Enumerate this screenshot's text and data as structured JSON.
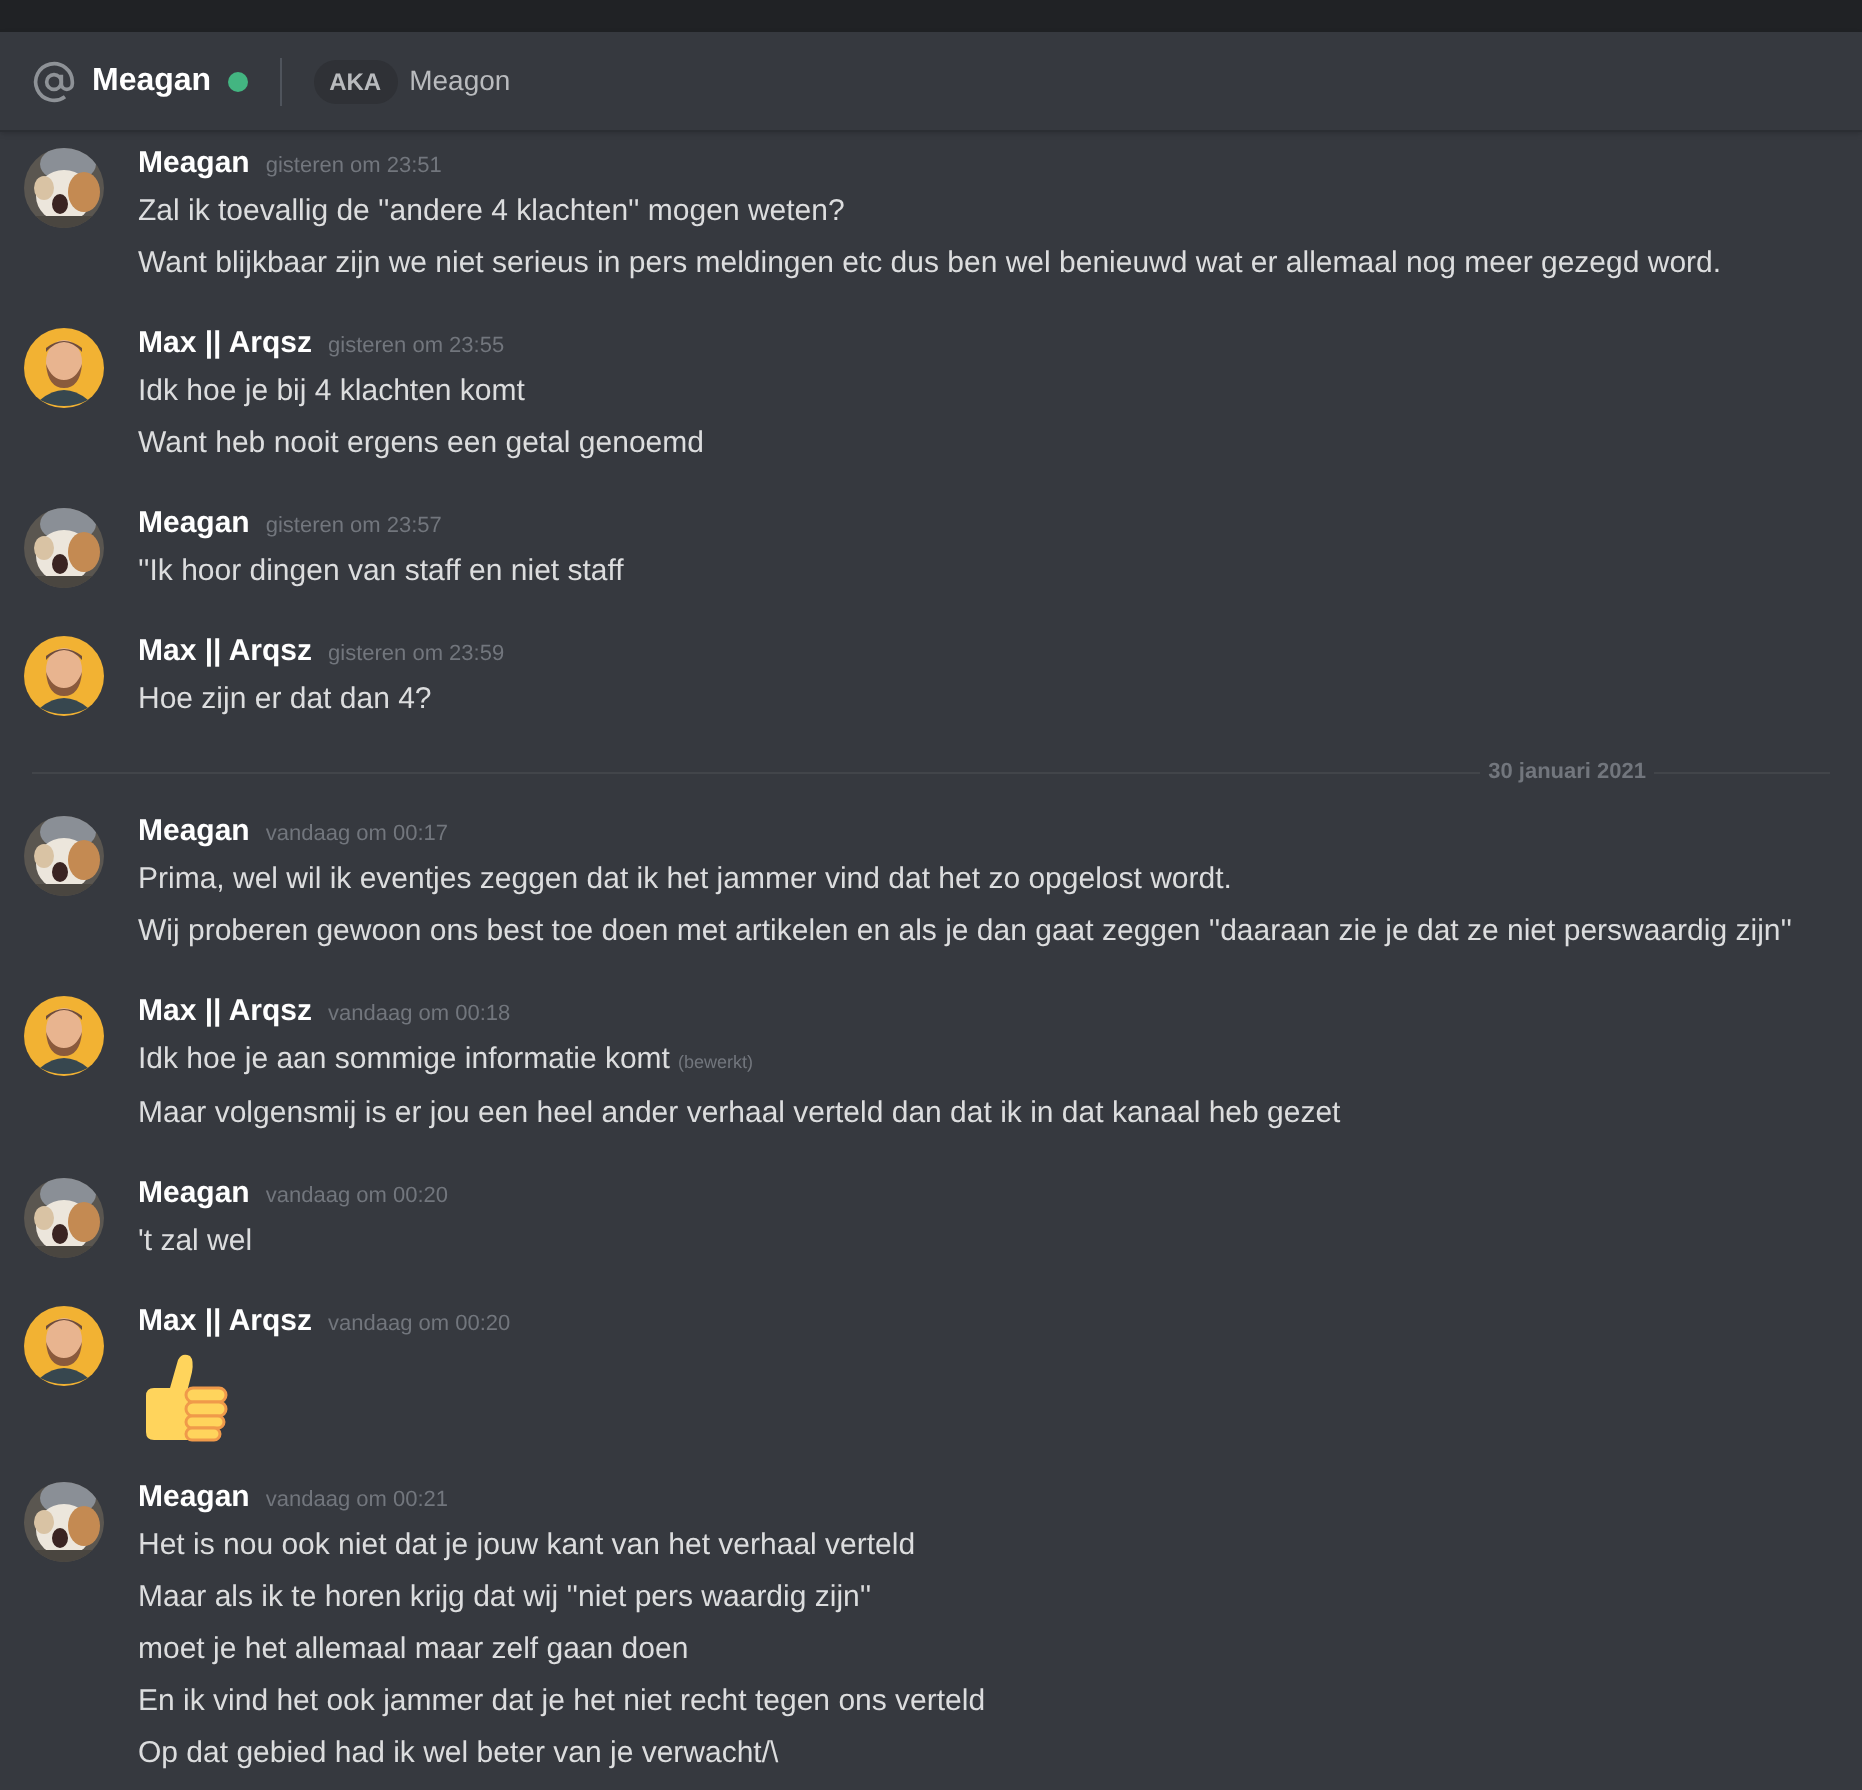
{
  "header": {
    "name": "Meagan",
    "online": true,
    "aka_label": "AKA",
    "aka_name": "Meagon"
  },
  "messages": [
    {
      "kind": "text",
      "avatar": {
        "kind": "picture"
      },
      "author": "Meagan",
      "time": "gisteren om 23:51",
      "lines": [
        {
          "text": "Zal ik toevallig de ''andere 4 klachten'' mogen weten?"
        },
        {
          "text": "Want blijkbaar zijn we niet serieus in pers meldingen etc dus ben wel benieuwd wat er allemaal nog meer gezegd word."
        }
      ]
    },
    {
      "kind": "text",
      "avatar": {
        "kind": "silhouette"
      },
      "author": "Max || Arqsz",
      "time": "gisteren om 23:55",
      "lines": [
        {
          "text": "Idk hoe je bij 4 klachten komt"
        },
        {
          "text": "Want heb nooit ergens een getal genoemd"
        }
      ]
    },
    {
      "kind": "text",
      "avatar": {
        "kind": "picture"
      },
      "author": "Meagan",
      "time": "gisteren om 23:57",
      "lines": [
        {
          "text": "''Ik hoor dingen van staff en niet staff"
        }
      ]
    },
    {
      "kind": "text",
      "avatar": {
        "kind": "silhouette"
      },
      "author": "Max || Arqsz",
      "time": "gisteren om 23:59",
      "lines": [
        {
          "text": "Hoe zijn er dat dan 4?"
        }
      ]
    },
    {
      "kind": "divider",
      "label": "30 januari 2021"
    },
    {
      "kind": "text",
      "avatar": {
        "kind": "picture"
      },
      "author": "Meagan",
      "time": "vandaag om 00:17",
      "lines": [
        {
          "text": "Prima, wel wil ik eventjes zeggen dat ik het jammer vind dat het zo opgelost wordt."
        },
        {
          "text": "Wij proberen gewoon ons best toe doen met artikelen en als je dan gaat zeggen ''daaraan zie je dat ze niet perswaardig zijn''"
        }
      ]
    },
    {
      "kind": "text",
      "avatar": {
        "kind": "silhouette"
      },
      "author": "Max || Arqsz",
      "time": "vandaag om 00:18",
      "lines": [
        {
          "text": "Idk hoe je aan sommige informatie komt",
          "edited": "(bewerkt)"
        },
        {
          "text": "Maar volgensmij is er jou een heel ander verhaal verteld dan dat ik in dat kanaal heb gezet"
        }
      ]
    },
    {
      "kind": "text",
      "avatar": {
        "kind": "picture"
      },
      "author": "Meagan",
      "time": "vandaag om 00:20",
      "lines": [
        {
          "text": "'t zal wel"
        }
      ]
    },
    {
      "kind": "emoji",
      "avatar": {
        "kind": "silhouette"
      },
      "author": "Max || Arqsz",
      "time": "vandaag om 00:20"
    },
    {
      "kind": "text",
      "avatar": {
        "kind": "picture"
      },
      "author": "Meagan",
      "time": "vandaag om 00:21",
      "lines": [
        {
          "text": "Het is nou ook niet dat je jouw kant van het verhaal verteld"
        },
        {
          "text": "Maar als ik te horen krijg dat wij ''niet pers waardig zijn''"
        },
        {
          "text": "moet je het allemaal maar zelf gaan doen"
        },
        {
          "text": "En ik vind het ook jammer dat je het niet recht tegen ons verteld"
        },
        {
          "text": "Op dat gebied had ik wel beter van je verwacht/\\"
        }
      ]
    }
  ]
}
